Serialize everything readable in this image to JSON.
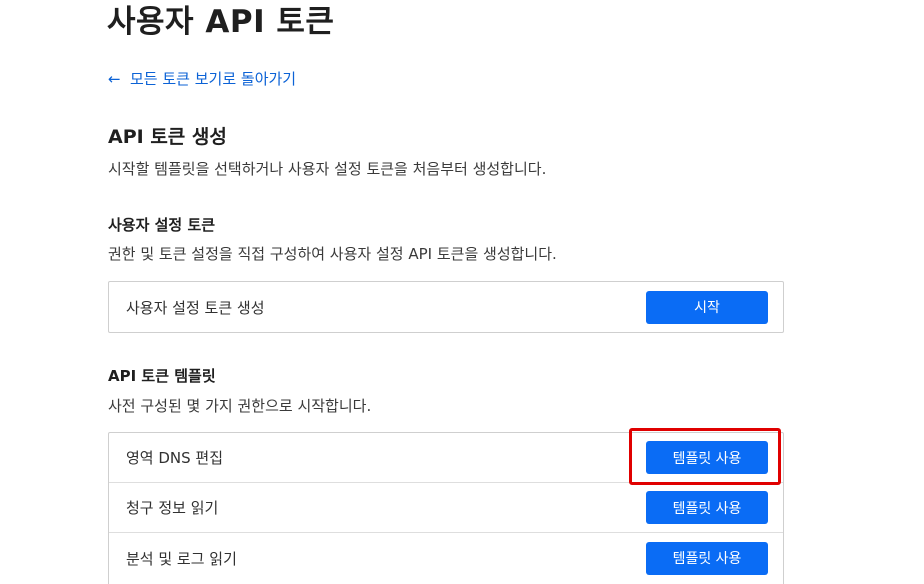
{
  "page": {
    "title": "사용자 API 토큰",
    "back_link": "모든 토큰 보기로 돌아가기",
    "back_arrow": "←"
  },
  "create": {
    "title": "API 토큰 생성",
    "description": "시작할 템플릿을 선택하거나 사용자 설정 토큰을 처음부터 생성합니다."
  },
  "custom": {
    "title": "사용자 설정 토큰",
    "description": "권한 및 토큰 설정을 직접 구성하여 사용자 설정 API 토큰을 생성합니다.",
    "row_label": "사용자 설정 토큰 생성",
    "button_label": "시작"
  },
  "templates": {
    "title": "API 토큰 템플릿",
    "description": "사전 구성된 몇 가지 권한으로 시작합니다.",
    "button_label": "템플릿 사용",
    "items": [
      {
        "label": "영역 DNS 편집"
      },
      {
        "label": "청구 정보 읽기"
      },
      {
        "label": "분석 및 로그 읽기"
      }
    ]
  },
  "colors": {
    "accent": "#0a6cf5",
    "link": "#0b62d6",
    "highlight": "#e00000"
  }
}
